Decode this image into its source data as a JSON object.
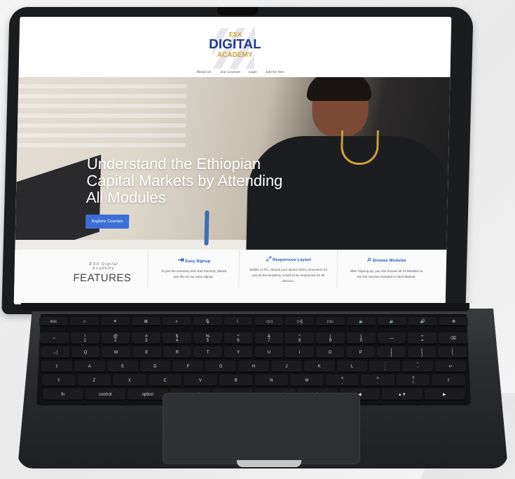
{
  "site": {
    "logo": {
      "line1": "ESX",
      "line2": "DIGITAL",
      "line3": "ACADEMY"
    },
    "nav": [
      "About Us",
      "Our Courses",
      "Login",
      "Join for free"
    ],
    "hero": {
      "headline": "Understand the Ethiopian Capital Markets by Attending All Modules",
      "cta": "Explore Courses"
    },
    "features": {
      "label_small": "ESX Digital Academy",
      "label_big": "FEATURES",
      "items": [
        {
          "icon": "sign-in-icon",
          "title": "Easy Signup",
          "desc": "To join the economy and start learning, please join this on our easy signup."
        },
        {
          "icon": "expand-icon",
          "title": "Responsive Layout",
          "desc": "Mobile or PC, choose your device that's convenient for you as the Academy is built to be responsive for all devices."
        },
        {
          "icon": "search-icon",
          "title": "Browse Modules",
          "desc": "After Signing up, you can browse all 16 Modules to see the courses included in each Module."
        }
      ]
    }
  },
  "keyboard": {
    "fn_row": [
      "esc",
      "☼",
      "☀",
      "⊞",
      "⌕",
      "🎙",
      "☾",
      "◁◁",
      "▷||",
      "▷▷",
      "🔈",
      "🔉",
      "🔊",
      "⊗"
    ],
    "num_row": [
      "~",
      "!\n1",
      "@\n2",
      "#\n3",
      "$\n4",
      "%\n5",
      "^\n6",
      "&\n7",
      "*\n8",
      "(\n9",
      ")\n0",
      "—",
      "+\n=",
      "⌫"
    ],
    "top_row": [
      "→|",
      "Q",
      "W",
      "E",
      "R",
      "T",
      "Y",
      "U",
      "I",
      "O",
      "P",
      "{\n[",
      "}\n]",
      "|\n\\"
    ],
    "home_row": [
      "⇪",
      "A",
      "S",
      "D",
      "F",
      "G",
      "H",
      "J",
      "K",
      "L",
      ":\n;",
      "\"\n'",
      "↩"
    ],
    "bottom_row": [
      "⇧",
      "Z",
      "X",
      "C",
      "V",
      "B",
      "N",
      "M",
      "<\n,",
      ">\n.",
      "?\n/",
      "⇧"
    ],
    "mod_row": [
      "fn",
      "control",
      "option",
      "command",
      "",
      "command",
      "option",
      "◀",
      "▲▼",
      "▶"
    ]
  },
  "colors": {
    "accent": "#3b6fd6",
    "gold": "#c9a43a",
    "navy": "#1f3b8c"
  }
}
